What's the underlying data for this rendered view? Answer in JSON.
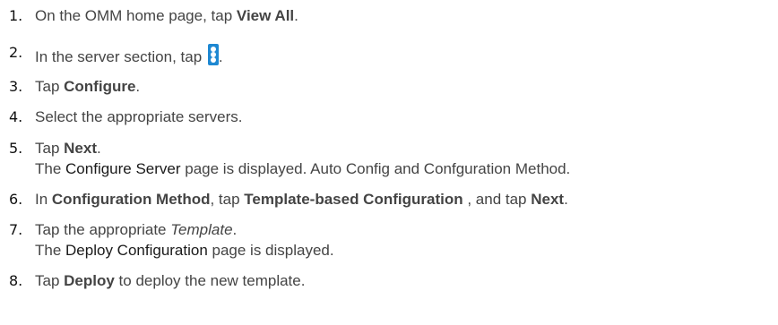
{
  "steps": [
    {
      "number": "1.",
      "pre": "On the OMM home page, tap ",
      "bold": "View All",
      "post": "."
    },
    {
      "number": "2.",
      "pre": "In the server section, tap ",
      "icon": "vertical-menu-icon",
      "post": "."
    },
    {
      "number": "3.",
      "pre": "Tap ",
      "bold": "Configure",
      "post": "."
    },
    {
      "number": "4.",
      "text": "Select the appropriate servers."
    },
    {
      "number": "5.",
      "pre": "Tap ",
      "bold": "Next",
      "post": ".",
      "result_ui": "Configure Server",
      "result_post": " page is displayed. Auto Config and Confguration Method.",
      "result_pre": "The "
    },
    {
      "number": "6.",
      "pre": "In ",
      "bold1": "Configuration Method",
      "mid1": ", tap ",
      "bold2": "Template-based Configuration",
      "mid2": " , and tap ",
      "bold3": "Next",
      "post": "."
    },
    {
      "number": "7.",
      "pre": "Tap the appropriate ",
      "italic": "Template",
      "post": ".",
      "result_pre": "The ",
      "result_ui": "Deploy Configuration",
      "result_post": " page is displayed."
    },
    {
      "number": "8.",
      "pre": "Tap ",
      "bold": "Deploy",
      "post": " to deploy the new template."
    }
  ],
  "colors": {
    "text": "#444444",
    "icon": "#1e88d2"
  }
}
